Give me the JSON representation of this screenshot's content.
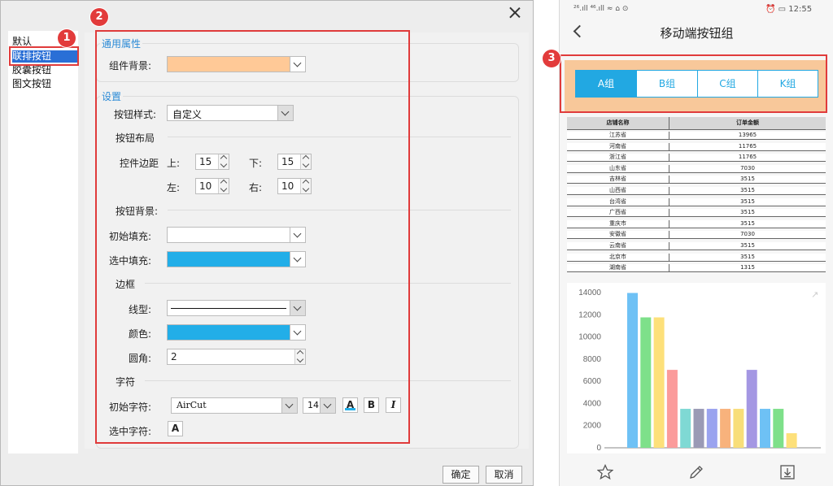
{
  "dialog": {
    "list_items": [
      "默认",
      "联排按钮",
      "胶囊按钮",
      "图文按钮"
    ],
    "selected_index": 1,
    "general": {
      "title": "通用属性",
      "bg_label": "组件背景:",
      "bg_color": "#ffc997"
    },
    "settings": {
      "title": "设置",
      "style_label": "按钮样式:",
      "style_value": "自定义",
      "layout_head": "按钮布局",
      "margin_label": "控件边距",
      "top_label": "上:",
      "top_value": "15",
      "bottom_label": "下:",
      "bottom_value": "15",
      "left_label": "左:",
      "left_value": "10",
      "right_label": "右:",
      "right_value": "10",
      "bg_head": "按钮背景:",
      "init_fill_label": "初始填充:",
      "init_fill_color": "#ffffff",
      "sel_fill_label": "选中填充:",
      "sel_fill_color": "#22aee8",
      "border_head": "边框",
      "line_label": "线型:",
      "color_label": "颜色:",
      "border_color": "#22aee8",
      "radius_label": "圆角:",
      "radius_value": "2",
      "font_head": "字符",
      "init_font_label": "初始字符:",
      "font_name": "AirCut",
      "font_size": "14",
      "sel_font_label": "选中字符:",
      "font_btn_a": "A",
      "font_btn_bold": "B",
      "font_btn_italic": "I",
      "font_btn_sel_a": "A"
    },
    "ok_label": "确定",
    "cancel_label": "取消"
  },
  "badges": [
    "1",
    "2",
    "3"
  ],
  "phone": {
    "status_left": "²⁶.ıll ⁴⁶.ıll ≈ ⌂ ⊙",
    "status_right": "⏰ ▭ 12:55",
    "title": "移动端按钮组",
    "segments": [
      "A组",
      "B组",
      "C组",
      "K组"
    ],
    "active_segment": 0,
    "table": {
      "headers": [
        "店铺名称",
        "订单金额"
      ],
      "rows": [
        [
          "江苏省",
          "13965"
        ],
        [
          "河南省",
          "11765"
        ],
        [
          "浙江省",
          "11765"
        ],
        [
          "山东省",
          "7030"
        ],
        [
          "吉林省",
          "3515"
        ],
        [
          "山西省",
          "3515"
        ],
        [
          "台湾省",
          "3515"
        ],
        [
          "广西省",
          "3515"
        ],
        [
          "重庆市",
          "3515"
        ],
        [
          "安徽省",
          "7030"
        ],
        [
          "云南省",
          "3515"
        ],
        [
          "北京市",
          "3515"
        ],
        [
          "湖南省",
          "1315"
        ]
      ]
    }
  },
  "chart_data": {
    "type": "bar",
    "values": [
      13965,
      11765,
      11765,
      7030,
      3515,
      3515,
      3515,
      3515,
      3515,
      7030,
      3515,
      3515,
      1315
    ],
    "colors": [
      "#6ec1f5",
      "#7ee08a",
      "#fde07a",
      "#fb9b9b",
      "#7fd9d4",
      "#9a9ab5",
      "#9aa3ef",
      "#f8b27c",
      "#f8de7a",
      "#a497e3",
      "#6ec1f5",
      "#7ee08a",
      "#fde07a"
    ],
    "ylim": [
      0,
      14000
    ],
    "yticks": [
      "0",
      "2000",
      "4000",
      "6000",
      "8000",
      "10000",
      "12000",
      "14000"
    ],
    "grid": false
  }
}
